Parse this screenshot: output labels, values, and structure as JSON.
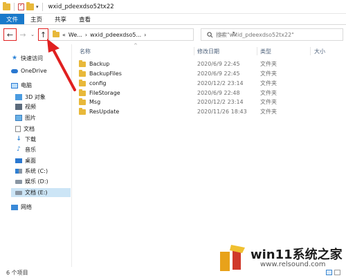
{
  "window": {
    "title": "wxid_pdeexdso52tx22",
    "colors": {
      "accent": "#1979ca",
      "annotation": "#e02020",
      "selection": "#cce5f6"
    }
  },
  "ribbon": {
    "tabs": [
      {
        "label": "文件",
        "active": true
      },
      {
        "label": "主页"
      },
      {
        "label": "共享"
      },
      {
        "label": "查看"
      }
    ]
  },
  "address": {
    "prefix": "«",
    "crumb1": "We...",
    "sep1": "›",
    "crumb2": "wxid_pdeexdso5...",
    "sep2": "›"
  },
  "search": {
    "placeholder": "搜索\"wxid_pdeexdso52tx22\""
  },
  "sidebar": {
    "items": [
      {
        "label": "快速访问",
        "icon": "star-icon"
      },
      {
        "label": "OneDrive",
        "icon": "cloud-icon"
      },
      {
        "label": "电脑",
        "icon": "pc-icon"
      },
      {
        "label": "3D 对象",
        "icon": "3d-objects-icon"
      },
      {
        "label": "视频",
        "icon": "video-icon"
      },
      {
        "label": "图片",
        "icon": "pictures-icon"
      },
      {
        "label": "文档",
        "icon": "documents-icon"
      },
      {
        "label": "下载",
        "icon": "download-icon"
      },
      {
        "label": "音乐",
        "icon": "music-icon"
      },
      {
        "label": "桌面",
        "icon": "desktop-icon"
      },
      {
        "label": "系统 (C:)",
        "icon": "system-drive-icon"
      },
      {
        "label": "娱乐 (D:)",
        "icon": "drive-icon"
      },
      {
        "label": "文档 (E:)",
        "icon": "drive-icon",
        "selected": true
      },
      {
        "label": "网络",
        "icon": "network-icon"
      }
    ]
  },
  "columns": {
    "name": "名称",
    "date": "修改日期",
    "type": "类型",
    "size": "大小"
  },
  "files": [
    {
      "name": "Backup",
      "date": "2020/6/9 22:45",
      "type": "文件夹"
    },
    {
      "name": "BackupFiles",
      "date": "2020/6/9 22:45",
      "type": "文件夹"
    },
    {
      "name": "config",
      "date": "2020/12/2 23:14",
      "type": "文件夹"
    },
    {
      "name": "FileStorage",
      "date": "2020/6/9 22:48",
      "type": "文件夹"
    },
    {
      "name": "Msg",
      "date": "2020/12/2 23:14",
      "type": "文件夹"
    },
    {
      "name": "ResUpdate",
      "date": "2020/11/26 18:43",
      "type": "文件夹"
    }
  ],
  "status": {
    "count": "6 个项目"
  },
  "watermark": {
    "text": "win11系统之家",
    "url": "www.relsound.com"
  }
}
